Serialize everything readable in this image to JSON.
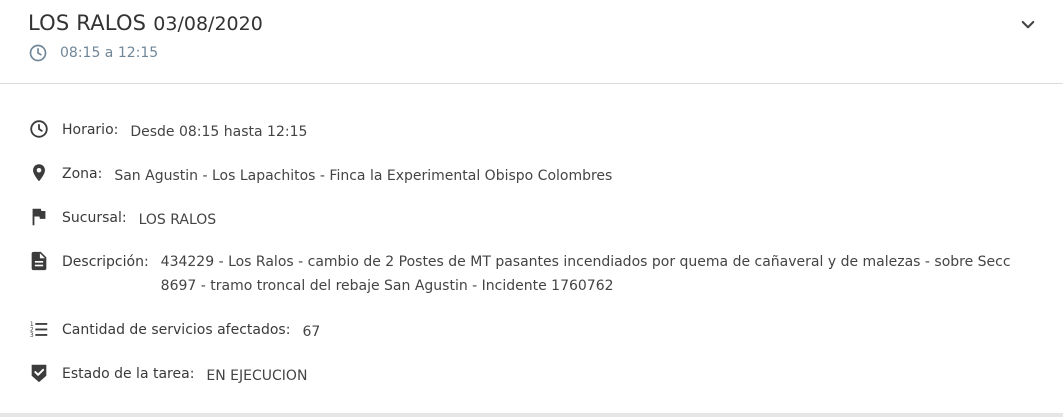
{
  "header": {
    "title": "LOS RALOS",
    "date": "03/08/2020",
    "time_range": "08:15 a 12:15"
  },
  "details": {
    "horario": {
      "label": "Horario:",
      "value": "Desde 08:15 hasta 12:15",
      "icon": "clock-icon"
    },
    "zona": {
      "label": "Zona:",
      "value": "San Agustin - Los Lapachitos - Finca la Experimental Obispo Colombres",
      "icon": "location-pin-icon"
    },
    "sucursal": {
      "label": "Sucursal:",
      "value": "LOS RALOS",
      "icon": "flag-icon"
    },
    "descripcion": {
      "label": "Descripción:",
      "value": "434229 - Los Ralos - cambio de 2 Postes de MT pasantes incendiados por quema de cañaveral y de malezas - sobre Secc 8697 - tramo troncal del rebaje San Agustin - Incidente 1760762",
      "icon": "document-icon"
    },
    "cantidad": {
      "label": "Cantidad de servicios afectados:",
      "value": "67",
      "icon": "list-icon"
    },
    "estado": {
      "label": "Estado de la tarea:",
      "value": "EN EJECUCION",
      "icon": "shield-check-icon"
    }
  },
  "colors": {
    "icon": "#3c3c3c",
    "time_text": "#6f8799",
    "divider": "#dcdcdc"
  }
}
